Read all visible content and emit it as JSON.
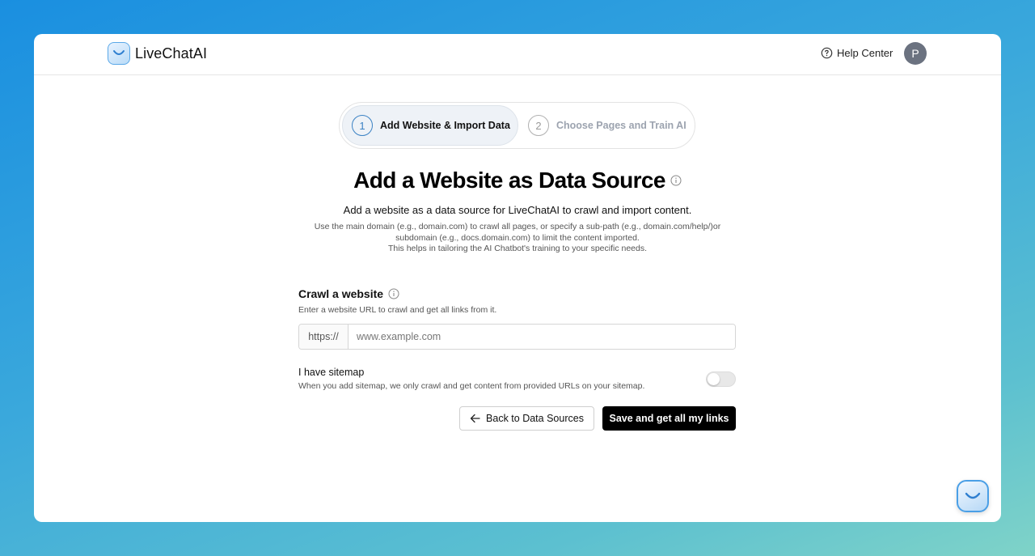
{
  "brand": {
    "name": "LiveChatAI",
    "icon": "smile-logo-icon",
    "accent": "#4a9fe6"
  },
  "header": {
    "help_label": "Help Center",
    "help_icon": "question-circle-icon",
    "avatar_initial": "P"
  },
  "stepper": {
    "steps": [
      {
        "number": "1",
        "label": "Add Website & Import Data",
        "active": true
      },
      {
        "number": "2",
        "label": "Choose Pages and Train AI",
        "active": false
      }
    ]
  },
  "main": {
    "title": "Add a Website as Data Source",
    "subtitle": "Add a website as a data source for LiveChatAI to crawl and import content.",
    "help_lines": [
      "Use the main domain (e.g., domain.com) to crawl all pages, or specify a sub-path (e.g., domain.com/help/)or",
      "subdomain (e.g., docs.domain.com) to limit the content imported.",
      "This helps in tailoring the AI Chatbot's training to your specific needs."
    ]
  },
  "crawl": {
    "title": "Crawl a website",
    "description": "Enter a website URL to crawl and get all links from it.",
    "prefix": "https://",
    "url_value": "",
    "url_placeholder": "www.example.com"
  },
  "sitemap": {
    "title": "I have sitemap",
    "description": "When you add sitemap, we only crawl and get content from provided URLs on your sitemap.",
    "enabled": false
  },
  "actions": {
    "back_label": "Back to Data Sources",
    "save_label": "Save and get all my links"
  }
}
